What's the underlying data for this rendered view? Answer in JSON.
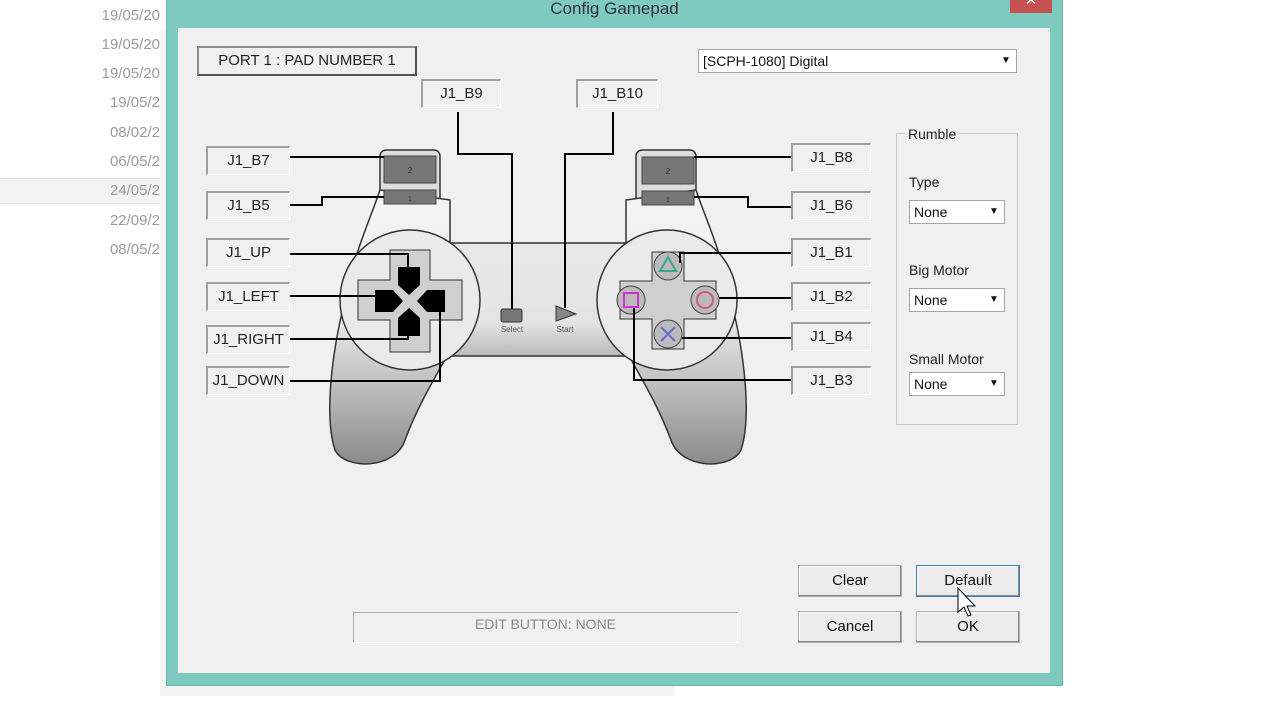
{
  "background_list": {
    "dates": [
      "19/05/20",
      "19/05/20",
      "19/05/20",
      "19/05/2",
      "08/02/2",
      "06/05/2",
      "24/05/2",
      "22/09/2",
      "08/05/2"
    ]
  },
  "window": {
    "title": "Config Gamepad",
    "close_label": "✕"
  },
  "port_label": "PORT 1 : PAD NUMBER 1",
  "controller_type": {
    "selected": "[SCPH-1080] Digital"
  },
  "bindings": {
    "select": "J1_B9",
    "start": "J1_B10",
    "l2": "J1_B7",
    "l1": "J1_B5",
    "up": "J1_UP",
    "left": "J1_LEFT",
    "right": "J1_RIGHT",
    "down": "J1_DOWN",
    "r2": "J1_B8",
    "r1": "J1_B6",
    "triangle": "J1_B1",
    "circle": "J1_B2",
    "cross": "J1_B4",
    "square": "J1_B3"
  },
  "pad_art": {
    "l2": "2",
    "l1": "1",
    "r2": "2",
    "r1": "1",
    "select": "Select",
    "start": "Start"
  },
  "rumble": {
    "title": "Rumble",
    "type_label": "Type",
    "type_value": "None",
    "big_label": "Big Motor",
    "big_value": "None",
    "small_label": "Small Motor",
    "small_value": "None"
  },
  "edit_status": "EDIT BUTTON: NONE",
  "buttons": {
    "clear": "Clear",
    "default": "Default",
    "cancel": "Cancel",
    "ok": "OK"
  },
  "colors": {
    "titlebar": "#7fcac0",
    "close": "#c75050",
    "triangle": "#3aa58f",
    "circle": "#d05a7a",
    "square": "#d62fd6",
    "cross": "#6a6ad0"
  }
}
